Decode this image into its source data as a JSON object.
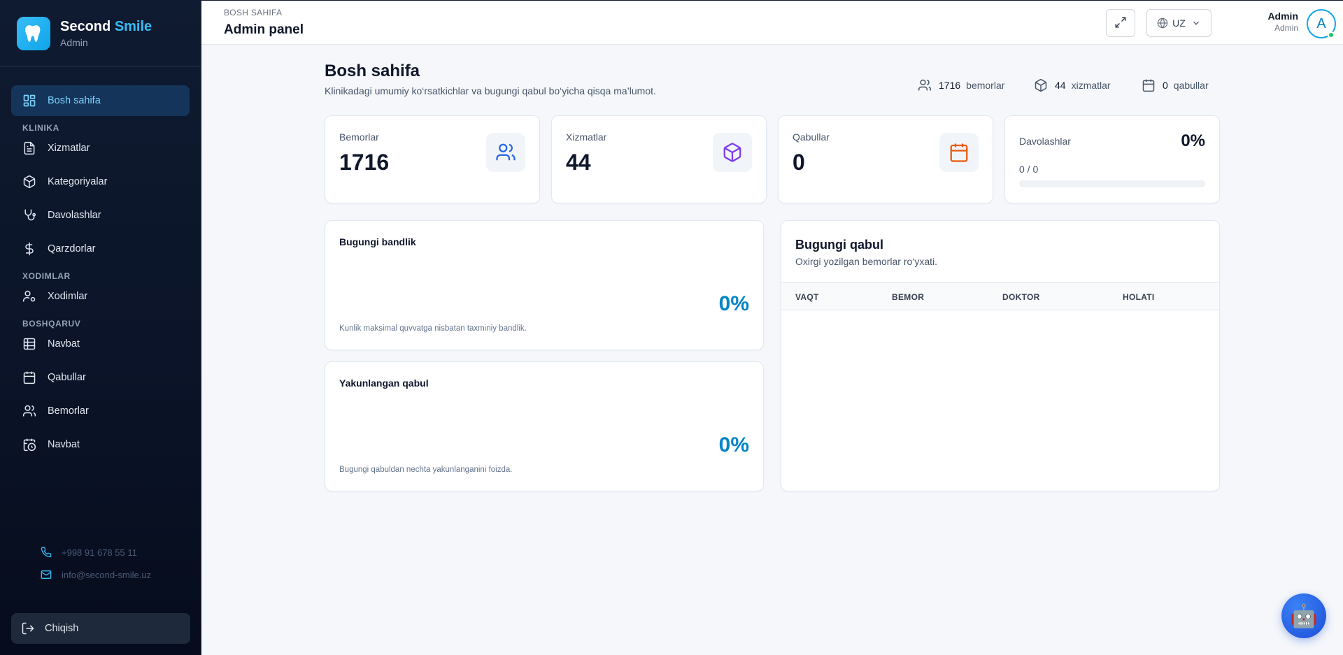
{
  "brand": {
    "name_part1": "Second",
    "name_part2": "Smile",
    "role": "Admin"
  },
  "sidebar": {
    "active": {
      "label": "Bosh sahifa",
      "icon": "dashboard-icon"
    },
    "sections": [
      {
        "title": "KLINIKA",
        "items": [
          {
            "label": "Xizmatlar",
            "icon": "file-text-icon"
          },
          {
            "label": "Kategoriyalar",
            "icon": "package-icon"
          },
          {
            "label": "Davolashlar",
            "icon": "stethoscope-icon"
          },
          {
            "label": "Qarzdorlar",
            "icon": "dollar-icon"
          }
        ]
      },
      {
        "title": "XODIMLAR",
        "items": [
          {
            "label": "Xodimlar",
            "icon": "user-cog-icon"
          }
        ]
      },
      {
        "title": "BOSHQARUV",
        "items": [
          {
            "label": "Navbat",
            "icon": "table-icon"
          },
          {
            "label": "Qabullar",
            "icon": "calendar-icon"
          },
          {
            "label": "Bemorlar",
            "icon": "users-icon"
          },
          {
            "label": "Navbat",
            "icon": "calendar-clock-icon"
          }
        ]
      }
    ],
    "contacts": {
      "phone": "+998 91 678 55 11",
      "email": "info@second-smile.uz"
    },
    "logout": "Chiqish"
  },
  "header": {
    "breadcrumb": "BOSH SAHIFA",
    "title": "Admin panel",
    "language": "UZ",
    "user": {
      "name": "Admin",
      "role": "Admin",
      "initial": "A"
    }
  },
  "page": {
    "title": "Bosh sahifa",
    "subtitle": "Klinikadagi umumiy ko‘rsatkichlar va bugungi qabul bo‘yicha qisqa ma’lumot.",
    "summary": [
      {
        "value": "1716",
        "label": "bemorlar",
        "icon": "users-icon"
      },
      {
        "value": "44",
        "label": "xizmatlar",
        "icon": "package-icon"
      },
      {
        "value": "0",
        "label": "qabullar",
        "icon": "calendar-icon"
      }
    ]
  },
  "stats": {
    "patients": {
      "label": "Bemorlar",
      "value": "1716",
      "icon": "users-icon",
      "color": "#2563eb"
    },
    "services": {
      "label": "Xizmatlar",
      "value": "44",
      "icon": "package-icon",
      "color": "#7c3aed"
    },
    "appointments": {
      "label": "Qabullar",
      "value": "0",
      "icon": "calendar-icon",
      "color": "#ea580c"
    },
    "treatments": {
      "label": "Davolashlar",
      "percent": "0%",
      "ratio": "0 / 0",
      "progress": 0
    }
  },
  "panels": {
    "occupancy": {
      "title": "Bugungi bandlik",
      "percent": "0%",
      "note": "Kunlik maksimal quvvatga nisbatan taxminiy bandlik."
    },
    "completed": {
      "title": "Yakunlangan qabul",
      "percent": "0%",
      "note": "Bugungi qabuldan nechta yakunlanganini foizda."
    }
  },
  "today_queue": {
    "title": "Bugungi qabul",
    "subtitle": "Oxirgi yozilgan bemorlar ro‘yxati.",
    "columns": [
      "VAQT",
      "BEMOR",
      "DOKTOR",
      "HOLATI"
    ],
    "rows": []
  },
  "assistant": {
    "icon": "robot-icon"
  },
  "colors": {
    "accent": "#0ea5e9",
    "sidebar_bg": "#0b1428",
    "active_bg": "#15345a"
  }
}
